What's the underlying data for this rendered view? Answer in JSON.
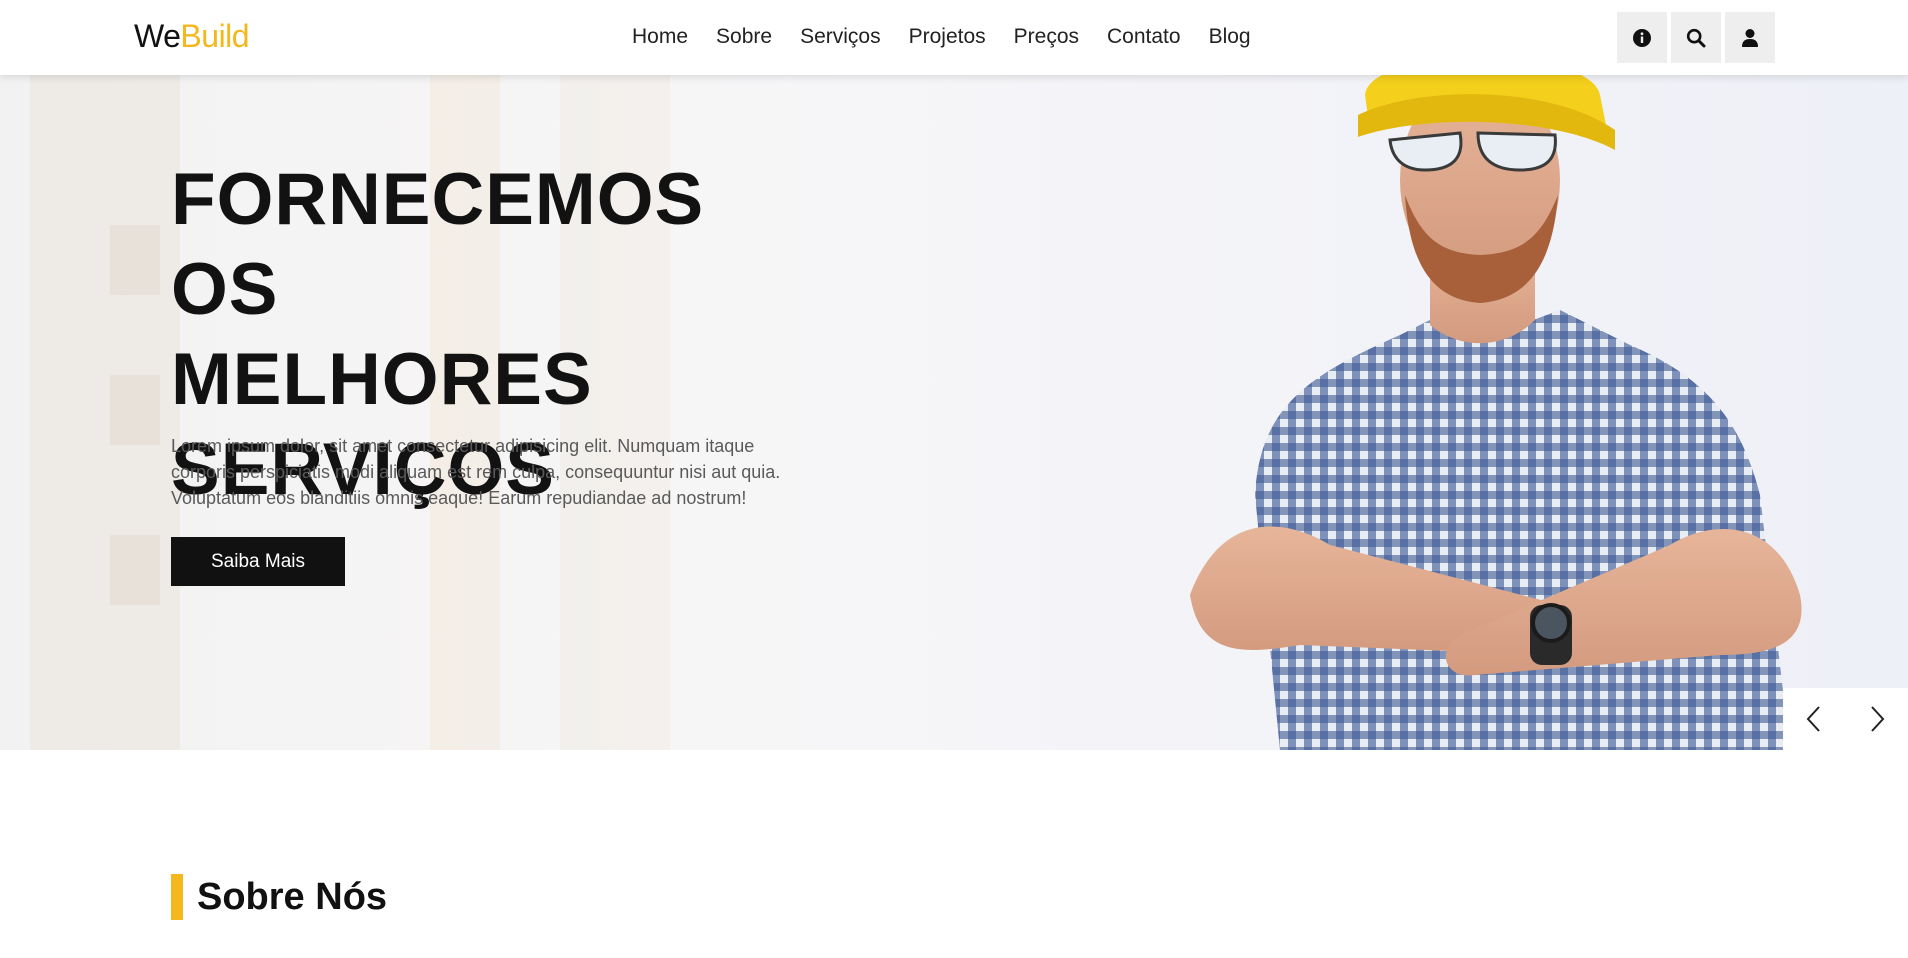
{
  "logo": {
    "part1": "We",
    "part2": "Build"
  },
  "nav": [
    "Home",
    "Sobre",
    "Serviços",
    "Projetos",
    "Preços",
    "Contato",
    "Blog"
  ],
  "header_icons": [
    "info-icon",
    "search-icon",
    "user-icon"
  ],
  "hero": {
    "title_lines": [
      "FORNECEMOS OS",
      "MELHORES",
      "SERVIÇOS"
    ],
    "text_lines": [
      "Lorem ipsum dolor, sit amet consectetur adipisicing elit. Numquam itaque",
      "corporis perspiciatis modi aliquam est rem culpa, consequuntur nisi aut quia.",
      "Voluptatum eos blanditiis omnis eaque! Earum repudiandae ad nostrum!"
    ],
    "button_label": "Saiba Mais"
  },
  "slider": {
    "prev_icon": "chevron-left-icon",
    "next_icon": "chevron-right-icon"
  },
  "about": {
    "title": "Sobre Nós"
  },
  "colors": {
    "accent": "#f4b81c",
    "dark": "#111111",
    "icon_bg": "#eeeeee"
  }
}
